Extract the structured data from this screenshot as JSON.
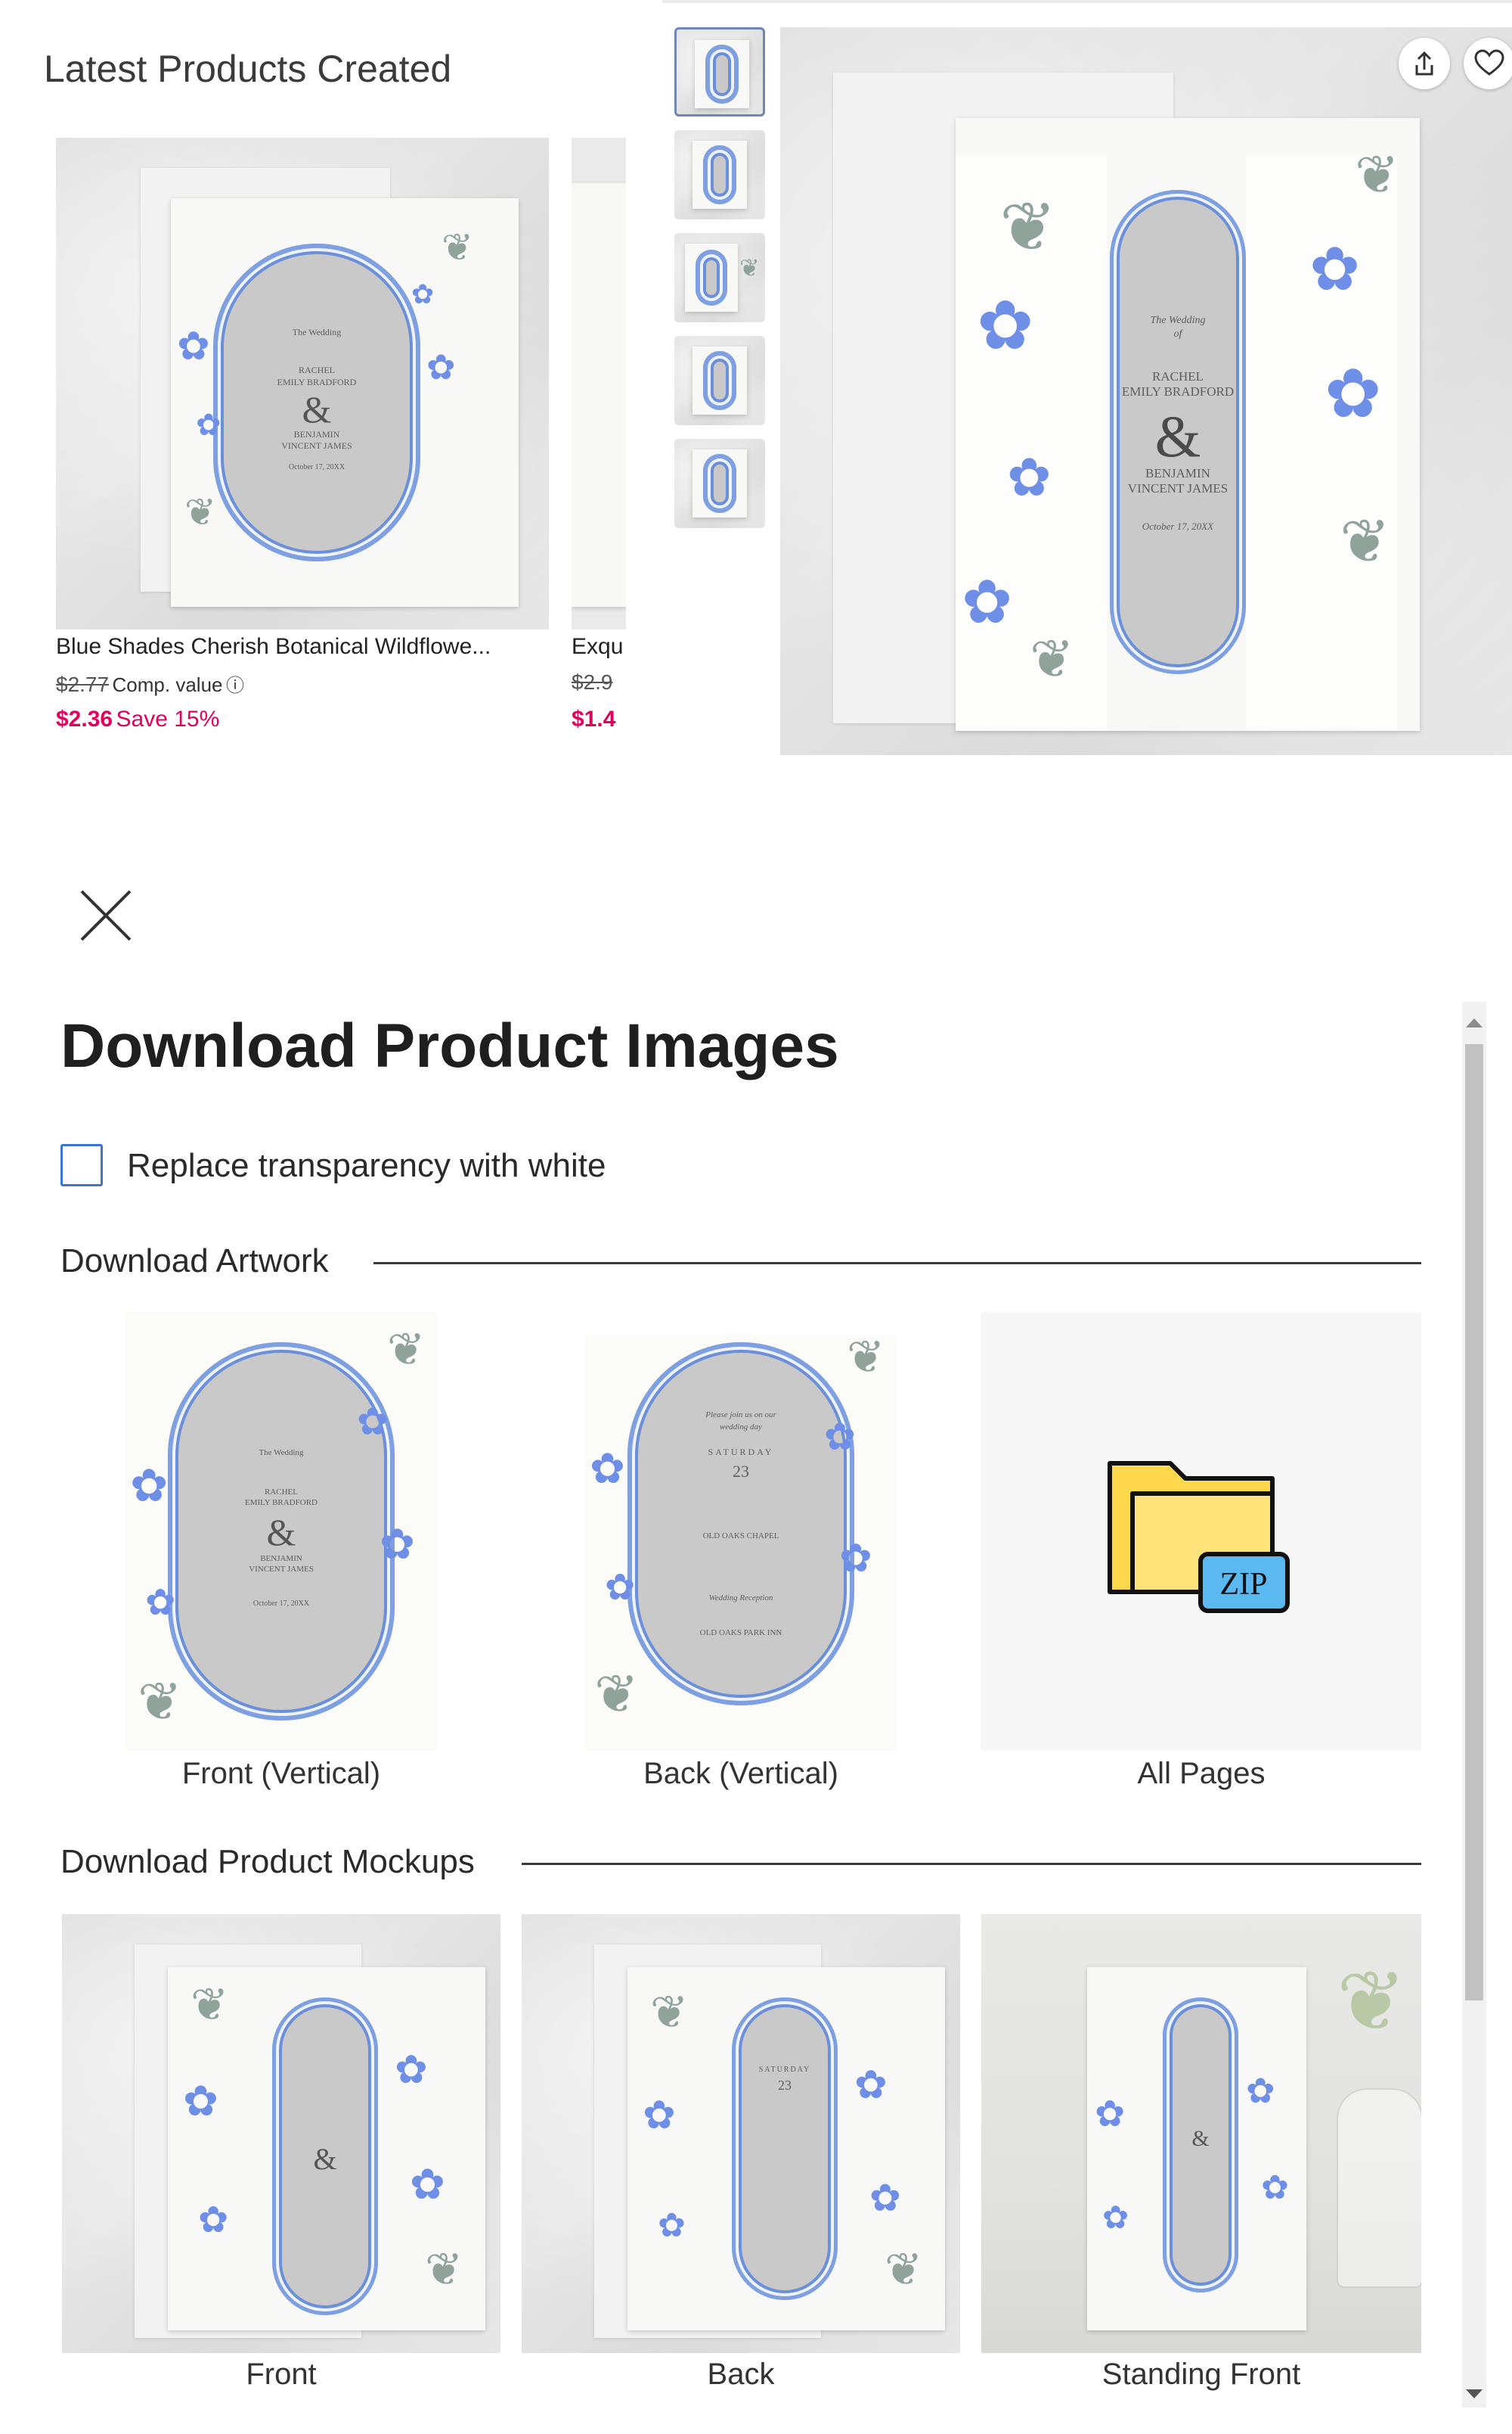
{
  "latest": {
    "title": "Latest Products Created",
    "products": [
      {
        "name": "Blue Shades Cherish Botanical Wildflowe...",
        "old_price": "$2.77",
        "comp_label": "Comp. value",
        "price": "$2.36",
        "save": "Save 15%"
      },
      {
        "name": "Exqu",
        "old_price": "$2.9",
        "price": "$1.4"
      }
    ]
  },
  "invitation": {
    "line1": "The Wedding",
    "line2": "of",
    "bride1": "RACHEL",
    "bride2": "EMILY BRADFORD",
    "amp": "&",
    "groom1": "BENJAMIN",
    "groom2": "VINCENT JAMES",
    "date": "October 17, 20XX"
  },
  "icons": {
    "share": "share-icon",
    "favorite": "heart-icon",
    "close": "close-icon",
    "zip_folder": "zip-folder-icon"
  },
  "modal": {
    "title": "Download Product Images",
    "checkbox_label": "Replace transparency with white",
    "checkbox_checked": false,
    "artwork_heading": "Download Artwork",
    "artwork_tiles": [
      {
        "label": "Front (Vertical)"
      },
      {
        "label": "Back (Vertical)"
      },
      {
        "label": "All Pages"
      }
    ],
    "zip_label": "ZIP",
    "mockups_heading": "Download Product Mockups",
    "mockup_tiles": [
      {
        "label": "Front"
      },
      {
        "label": "Back"
      },
      {
        "label": "Standing Front"
      }
    ]
  },
  "back_card": {
    "line1": "Please join us on our",
    "line2": "wedding day",
    "day": "SATURDAY",
    "date": "23",
    "venue": "OLD OAKS CHAPEL",
    "reception": "Wedding Reception",
    "park": "OLD OAKS PARK INN"
  },
  "colors": {
    "sale": "#e3005c",
    "checkbox_border": "#3b73d6",
    "floral_blue": "#6f8fe6",
    "zip_folder": "#ffd84d",
    "zip_badge": "#5bb8f0"
  }
}
